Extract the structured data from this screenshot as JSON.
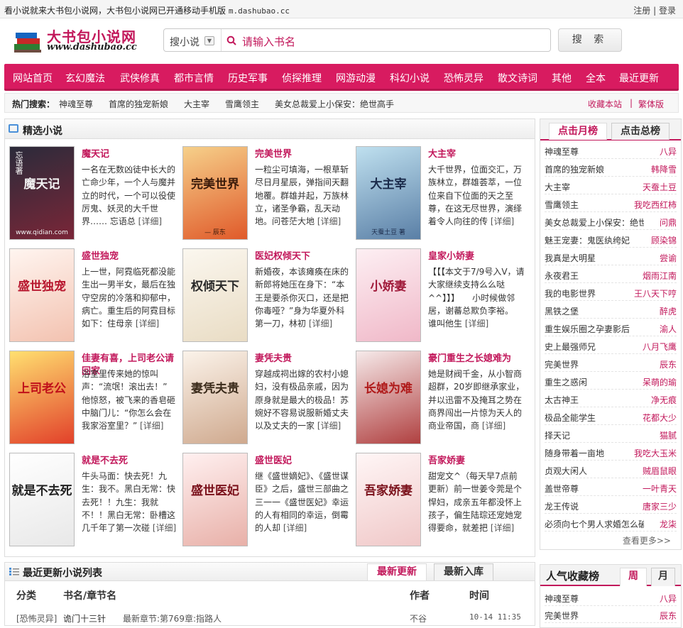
{
  "topbar": {
    "slogan": "看小说就来大书包小说网，大书包小说网已开通移动手机版",
    "mobile_url": "m.dashubao.cc",
    "register": "注册",
    "sep": "|",
    "login": "登录"
  },
  "logo": {
    "title": "大书包小说网",
    "url": "www.dashubao.cc"
  },
  "search": {
    "scope": "搜小说",
    "placeholder": "请输入书名",
    "button": "搜 索"
  },
  "nav": [
    "网站首页",
    "玄幻魔法",
    "武侠修真",
    "都市言情",
    "历史军事",
    "侦探推理",
    "网游动漫",
    "科幻小说",
    "恐怖灵异",
    "散文诗词",
    "其他",
    "全本",
    "最近更新"
  ],
  "hot": {
    "label": "热门搜索：",
    "items": [
      "神魂至尊",
      "首席的独宠新娘",
      "大主宰",
      "雪鹰领主",
      "美女总裁爱上小保安：绝世高手"
    ],
    "bookmark": "收藏本站",
    "sep": "|",
    "traditional": "繁体版"
  },
  "featured": {
    "title": "精选小说",
    "books": [
      {
        "title": "魔天记",
        "cover": "魔天记",
        "cover_top": "忘语著",
        "cover_footer": "www.qidian.com",
        "desc": "一名在无数凶徒中长大的亡命少年，一个人与魔并立的时代，一个可以役使厉鬼、妖灵的大千世界…… 忘语总",
        "more": "[详细]"
      },
      {
        "title": "完美世界",
        "cover": "完美世界",
        "cover_top": "",
        "cover_footer": "— 辰东",
        "desc": "一粒尘可填海，一根草斩尽日月星辰，弹指间天翻地覆。群雄并起，万族林立，诸圣争霸，乱天动地。问苍茫大地",
        "more": "[详细]"
      },
      {
        "title": "大主宰",
        "cover": "大主宰",
        "cover_top": "",
        "cover_footer": "天蚕土豆 著",
        "desc": "大千世界，位面交汇，万族林立，群雄荟萃，一位位来自下位面的天之至尊，在这无尽世界，演绎着令人向往的传",
        "more": "[详细]"
      },
      {
        "title": "盛世独宠",
        "cover": "盛世独宠",
        "cover_top": "",
        "cover_footer": "",
        "desc": "上一世，阿霓临死都没能生出一男半女，最后在独守空房的冷落和抑郁中，病亡。重生后的阿霓目标如下：住母亲",
        "more": "[详细]"
      },
      {
        "title": "医妃权倾天下",
        "cover": "权倾天下",
        "cover_top": "",
        "cover_footer": "",
        "desc": "新婚夜，本该瘫痪在床的新郎将她压在身下：“本王是要杀你灭口，还是把你毒哑？”身为华夏外科第一刀，林初",
        "more": "[详细]"
      },
      {
        "title": "皇家小娇妻",
        "cover": "小娇妻",
        "cover_top": "",
        "cover_footer": "",
        "desc": "【【【本文于7/9号入V，请大家继续支持么么哒^^】】】　　小时候做邻居，谢蕃总欺负李裕。　谁叫他生",
        "more": "[详细]"
      },
      {
        "title": "佳妻有喜，上司老公请回家",
        "cover": "上司老公",
        "cover_top": "",
        "cover_footer": "",
        "desc": "浴室里传来她的惊叫声：“流氓！滚出去！”　他惊怒，被飞来的香皂砸中脑门儿：“你怎么会在我家浴室里？”",
        "more": "[详细]"
      },
      {
        "title": "妻凭夫贵",
        "cover": "妻凭夫贵",
        "cover_top": "",
        "cover_footer": "",
        "desc": "穿越成祠出嫁的农村小媳妇，没有极品亲戚，因为原身就是最大的极品！苏婉好不容易说服新婚丈夫以及丈夫的一家",
        "more": "[详细]"
      },
      {
        "title": "豪门重生之长媳难为",
        "cover": "长媳为难",
        "cover_top": "",
        "cover_footer": "",
        "desc": "她是财阀千金，从小智商超群，20岁即继承家业，并以迅雷不及掩耳之势在商界闯出一片惊为天人的商业帝国，商",
        "more": "[详细]"
      },
      {
        "title": "就是不去死",
        "cover": "就是不去死",
        "cover_top": "",
        "cover_footer": "",
        "desc": "牛头马面：快去死！九生：我不。黑白无常：快去死！！九生：我就不！！黑白无常：卧槽这几千年了第一次碰",
        "more": "[详细]"
      },
      {
        "title": "盛世医妃",
        "cover": "盛世医妃",
        "cover_top": "",
        "cover_footer": "",
        "desc": "继《盛世嫡妃》、《盛世谋臣》之后，盛世三部曲之三一一《盛世医妃》幸运的人有相同的幸运，倒霉的人却",
        "more": "[详细]"
      },
      {
        "title": "吾家娇妻",
        "cover": "吾家娇妻",
        "cover_top": "",
        "cover_footer": "",
        "desc": "甜宠文^（每天早7点前更新）前一世姜令莞是个悍妇，成亲五年都没怀上孩子，偏生陆琮还宠她宠得要命，就差把",
        "more": "[详细]"
      }
    ]
  },
  "rank": {
    "tab_month": "点击月榜",
    "tab_total": "点击总榜",
    "items": [
      {
        "book": "神魂至尊",
        "author": "八异"
      },
      {
        "book": "首席的独宠新娘",
        "author": "韩降雪"
      },
      {
        "book": "大主宰",
        "author": "天蚕土豆"
      },
      {
        "book": "雪鹰领主",
        "author": "我吃西红柿"
      },
      {
        "book": "美女总裁爱上小保安：绝世高手",
        "author": "问鼎"
      },
      {
        "book": "魅王宠妻：鬼医纨绔妃",
        "author": "顾染锦"
      },
      {
        "book": "我真是大明星",
        "author": "尝谕"
      },
      {
        "book": "永夜君王",
        "author": "烟雨江南"
      },
      {
        "book": "我的电影世界",
        "author": "王八天下哼"
      },
      {
        "book": "黑铁之堡",
        "author": "醉虎"
      },
      {
        "book": "重生娱乐圈之孕妻影后",
        "author": "渝人"
      },
      {
        "book": "史上最强师兄",
        "author": "八月飞鹰"
      },
      {
        "book": "完美世界",
        "author": "辰东"
      },
      {
        "book": "重生之惑闲",
        "author": "呆萌的瑜"
      },
      {
        "book": "太古神王",
        "author": "净无痕"
      },
      {
        "book": "极品全能学生",
        "author": "花都大少"
      },
      {
        "book": "择天记",
        "author": "猫腻"
      },
      {
        "book": "随身带着一亩地",
        "author": "我吃大玉米"
      },
      {
        "book": "贞观大闲人",
        "author": "贼眉鼠眼"
      },
      {
        "book": "盖世帝尊",
        "author": "一叶青天"
      },
      {
        "book": "龙王传说",
        "author": "唐家三少"
      },
      {
        "book": "必须向七个男人求婚怎么破！",
        "author": "龙柒"
      }
    ],
    "more": "查看更多>>"
  },
  "latest": {
    "title": "最近更新小说列表",
    "tab_update": "最新更新",
    "tab_new": "最新入库",
    "col_cat": "分类",
    "col_book": "书名/章节名",
    "col_author": "作者",
    "col_time": "时间",
    "rows": [
      {
        "cat": "[恐怖灵异]",
        "book": "诡门十三针",
        "chapter": "最新章节:第769章:指路人",
        "author": "不谷",
        "time": "10-14 11:35"
      }
    ]
  },
  "popular": {
    "title": "人气收藏榜",
    "tab_week": "周",
    "tab_month": "月",
    "items": [
      {
        "book": "神魂至尊",
        "author": "八异"
      },
      {
        "book": "完美世界",
        "author": "辰东"
      }
    ]
  },
  "colors": {
    "brand": "#d81b60",
    "accent": "#c2185b"
  }
}
